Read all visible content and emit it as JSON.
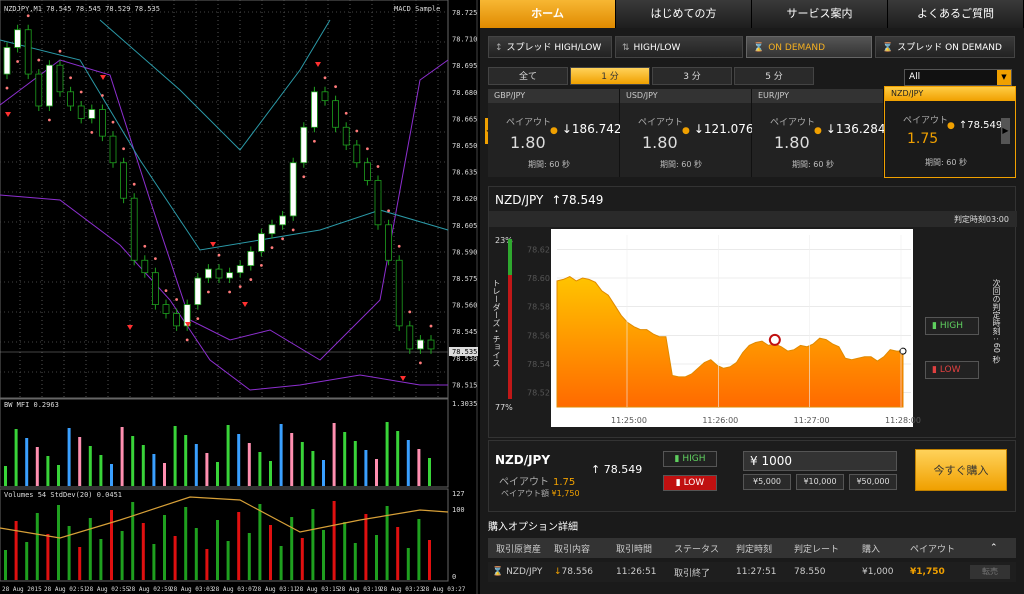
{
  "mt4": {
    "chart_header": "NZDJPY,M1  78.545 78.545 78.529 78.535",
    "indicator_name": "MACD Sample",
    "price_ticks": [
      "78.725",
      "78.710",
      "78.695",
      "78.680",
      "78.665",
      "78.650",
      "78.635",
      "78.620",
      "78.605",
      "78.590",
      "78.575",
      "78.560",
      "78.545",
      "78.530",
      "78.515"
    ],
    "current_price": "78.535",
    "bw_mfi_label": "BW MFI 0.2963",
    "bw_mfi_max": "1.3035",
    "volumes_label": "Volumes 54  StdDev(20) 0.0451",
    "vol_ticks": [
      "127",
      "100",
      "0"
    ],
    "time_ticks": [
      "28 Aug 2015",
      "28 Aug 02:51",
      "28 Aug 02:55",
      "28 Aug 02:59",
      "28 Aug 03:03",
      "28 Aug 03:07",
      "28 Aug 03:11",
      "28 Aug 03:15",
      "28 Aug 03:19",
      "28 Aug 03:23",
      "28 Aug 03:27"
    ],
    "colors": {
      "bull": "#ffffff",
      "bear": "#000000",
      "mfi_green": "#39d439",
      "mfi_blue": "#3aa0ff",
      "mfi_pink": "#ff8fb0",
      "vol_green": "#1fa01f",
      "vol_red": "#e01010",
      "stddev": "#d7a038",
      "envelope_purple": "#8d2fd0",
      "envelope_teal": "#2b9aa8",
      "sar": "#ff7a7a",
      "fractal": "#ff3030"
    }
  },
  "nav": {
    "tabs": [
      "ホーム",
      "はじめての方",
      "サービス案内",
      "よくあるご質問"
    ],
    "active": 0
  },
  "product_tabs": [
    {
      "label": "スプレッド HIGH/LOW",
      "icon": "↕"
    },
    {
      "label": "HIGH/LOW",
      "icon": "⇅"
    },
    {
      "label": "ON DEMAND",
      "icon": "⌛"
    },
    {
      "label": "スプレッド ON DEMAND",
      "icon": "⌛"
    }
  ],
  "expiry_tabs": [
    "全て",
    "1 分",
    "3 分",
    "5 分"
  ],
  "asset_filter": {
    "value": "All"
  },
  "assets": [
    {
      "pair": "GBP/JPY",
      "payout_label": "ペイアウト",
      "payout": "1.80",
      "direction": "↓",
      "rate": "186.742",
      "period": "期間: 60 秒"
    },
    {
      "pair": "USD/JPY",
      "payout_label": "ペイアウト",
      "payout": "1.80",
      "direction": "↓",
      "rate": "121.076",
      "period": "期間: 60 秒"
    },
    {
      "pair": "EUR/JPY",
      "payout_label": "ペイアウト",
      "payout": "1.80",
      "direction": "↓",
      "rate": "136.284",
      "period": "期間: 60 秒"
    },
    {
      "pair": "NZD/JPY",
      "payout_label": "ペイアウト",
      "payout": "1.75",
      "direction": "↑",
      "rate": "78.549",
      "period": "期間: 60 秒"
    }
  ],
  "main_chart": {
    "pair": "NZD/JPY",
    "direction": "↑",
    "rate": "78.549",
    "judge_time": "判定時刻03:00",
    "pct_top": "23%",
    "pct_bottom": "77%",
    "trader_choice": "トレーダーズ・チョイス",
    "next_judge": "次回の判定時刻 : 60 秒",
    "high_label": "HIGH",
    "low_label": "LOW"
  },
  "chart_data": {
    "type": "area",
    "x": [
      "11:25:00",
      "11:26:00",
      "11:27:00",
      "11:28:00"
    ],
    "ylim": [
      78.51,
      78.63
    ],
    "yticks": [
      "78.62",
      "78.60",
      "78.58",
      "78.56",
      "78.54",
      "78.52"
    ],
    "series": [
      {
        "values": [
          78.598,
          78.599,
          78.601,
          78.598,
          78.6,
          78.599,
          78.597,
          78.591,
          78.588,
          78.581,
          78.574,
          78.569,
          78.566,
          78.564,
          78.564,
          78.561,
          78.559,
          78.559,
          78.532,
          78.531,
          78.531,
          78.533,
          78.537,
          78.541,
          78.543,
          78.539,
          78.537,
          78.538,
          78.541,
          78.548,
          78.553,
          78.555,
          78.556,
          78.553,
          78.554,
          78.552,
          78.549,
          78.55,
          78.553,
          78.552,
          78.554,
          78.558,
          78.557,
          78.554,
          78.552,
          78.544,
          78.543,
          78.544,
          78.545,
          78.545,
          78.542,
          78.545,
          78.55,
          78.549,
          78.549
        ]
      }
    ]
  },
  "order": {
    "pair": "NZD/JPY",
    "direction": "↑",
    "rate": "78.549",
    "payout_label": "ペイアウト",
    "payout": "1.75",
    "payout_amount_label": "ペイアウト額",
    "payout_amount": "¥1,750",
    "high_label": "HIGH",
    "low_label": "LOW",
    "amount": "¥ 1000",
    "presets": [
      "¥5,000",
      "¥10,000",
      "¥50,000"
    ],
    "buy_label": "今すぐ購入"
  },
  "details": {
    "title": "購入オプション詳細",
    "headers": [
      "取引原資産",
      "取引内容",
      "取引時間",
      "ステータス",
      "判定時刻",
      "判定レート",
      "購入",
      "ペイアウト"
    ],
    "rows": [
      {
        "asset": "NZD/JPY",
        "content_dir": "↓",
        "content": "78.556",
        "time": "11:26:51",
        "status": "取引終了",
        "judge": "11:27:51",
        "rate": "78.550",
        "purchase": "¥1,000",
        "payout": "¥1,750",
        "action": "転売"
      }
    ]
  }
}
